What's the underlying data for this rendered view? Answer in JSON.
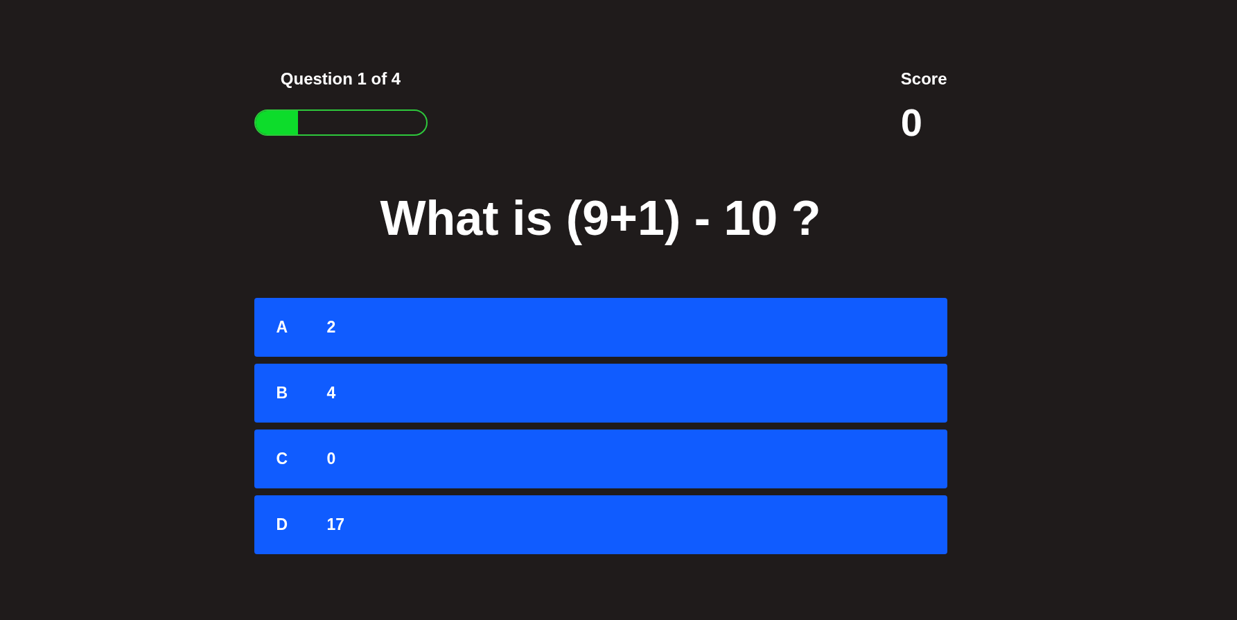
{
  "header": {
    "progress": {
      "label": "Question 1 of 4",
      "level": 0.25
    },
    "score": {
      "label": "Score",
      "value": "0"
    }
  },
  "question": {
    "text": "What is (9+1) - 10 ?"
  },
  "answers": [
    {
      "letter": "A",
      "text": "2",
      "selected": false
    },
    {
      "letter": "B",
      "text": "4",
      "selected": false
    },
    {
      "letter": "C",
      "text": "0",
      "selected": false
    },
    {
      "letter": "D",
      "text": "17",
      "selected": false
    }
  ]
}
